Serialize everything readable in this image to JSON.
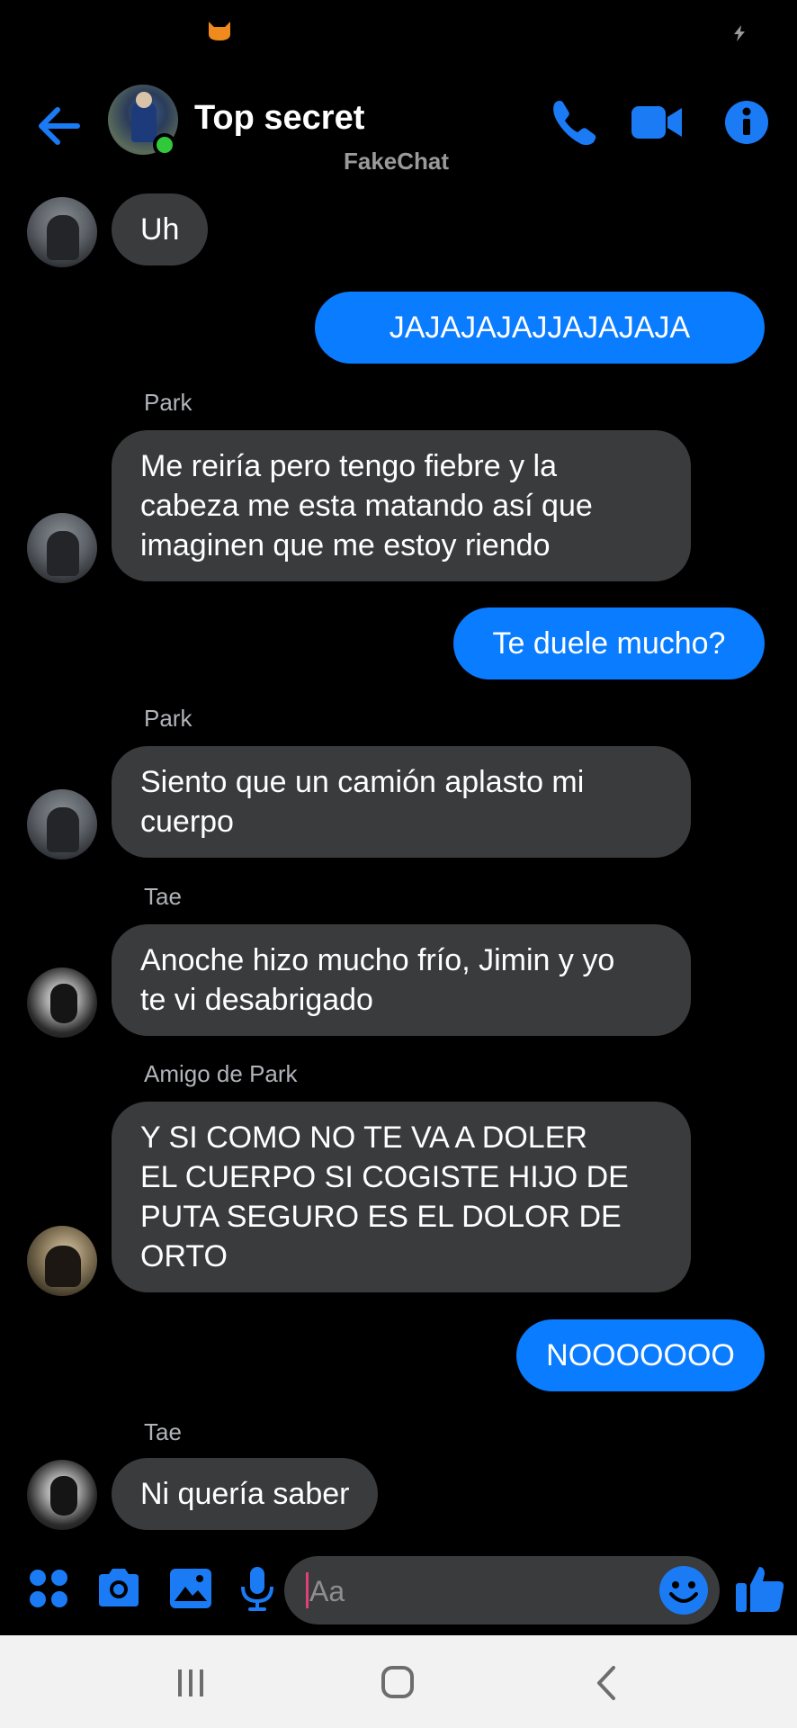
{
  "status_bar": {
    "left_icon": "cat-icon",
    "right_icon": "charging-bolt-icon"
  },
  "header": {
    "title": "Top secret",
    "watermark": "FakeChat",
    "back_icon": "back-arrow-icon",
    "phone_icon": "phone-icon",
    "video_icon": "video-camera-icon",
    "info_icon": "info-icon",
    "online": true
  },
  "messages": [
    {
      "direction": "in",
      "sender": "",
      "text": "Uh"
    },
    {
      "direction": "out",
      "text": "JAJAJAJAJJAJAJAJA"
    },
    {
      "direction": "in",
      "sender": "Park",
      "lines": [
        "Me reiría pero tengo fiebre y la",
        "cabeza me esta matando así que",
        "imaginen que me estoy riendo"
      ]
    },
    {
      "direction": "out",
      "text": "Te duele mucho?"
    },
    {
      "direction": "in",
      "sender": "Park",
      "lines": [
        "Siento que un camión aplasto mi",
        "cuerpo"
      ]
    },
    {
      "direction": "in",
      "sender": "Tae",
      "lines": [
        "Anoche hizo mucho frío, Jimin y yo",
        "te vi desabrigado"
      ]
    },
    {
      "direction": "in",
      "sender": "Amigo de Park",
      "lines": [
        "Y SI COMO NO TE VA A DOLER",
        "EL CUERPO SI COGISTE HIJO DE",
        "PUTA SEGURO ES EL DOLOR DE",
        "ORTO"
      ]
    },
    {
      "direction": "out",
      "text": "NOOOOOOO"
    },
    {
      "direction": "in",
      "sender": "Tae",
      "text": "Ni quería saber"
    }
  ],
  "composer": {
    "placeholder": "Aa",
    "value": "",
    "icons": [
      "apps-icon",
      "camera-icon",
      "image-icon",
      "microphone-icon",
      "emoji-icon",
      "thumbs-up-icon"
    ]
  },
  "nav_bar": {
    "icons": [
      "recent-apps-icon",
      "home-icon",
      "back-icon"
    ]
  },
  "colors": {
    "accent": "#0a7cff",
    "incoming_bubble": "#3a3b3c",
    "background": "#000000",
    "online": "#31c93b"
  }
}
